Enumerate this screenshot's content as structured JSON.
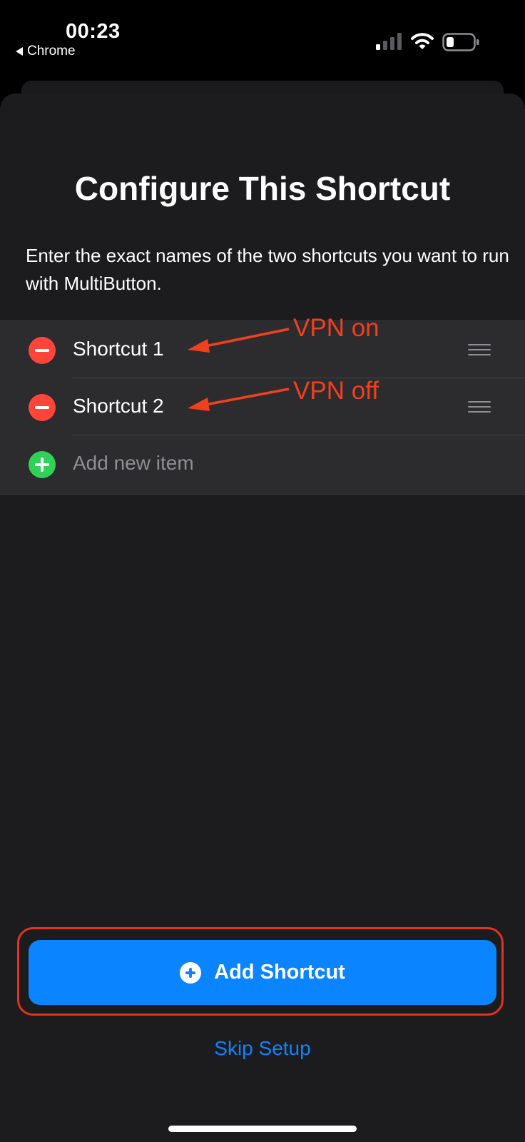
{
  "status_bar": {
    "time": "00:23",
    "back_app": "Chrome",
    "signal_icon": "cellular-signal-icon",
    "wifi_icon": "wifi-icon",
    "battery_icon": "battery-icon"
  },
  "sheet": {
    "title": "Configure This Shortcut",
    "description": "Enter the exact names of the two shortcuts you want to run with MultiButton.",
    "items": [
      {
        "label": "Shortcut 1",
        "annotation": "VPN on"
      },
      {
        "label": "Shortcut 2",
        "annotation": "VPN off"
      }
    ],
    "add_item_placeholder": "Add new item"
  },
  "actions": {
    "add_shortcut_label": "Add Shortcut",
    "skip_label": "Skip Setup"
  },
  "colors": {
    "accent": "#0a84ff",
    "remove": "#ff453a",
    "add": "#30d158",
    "annotation": "#f0401e",
    "sheet_background": "#1c1c1e"
  }
}
